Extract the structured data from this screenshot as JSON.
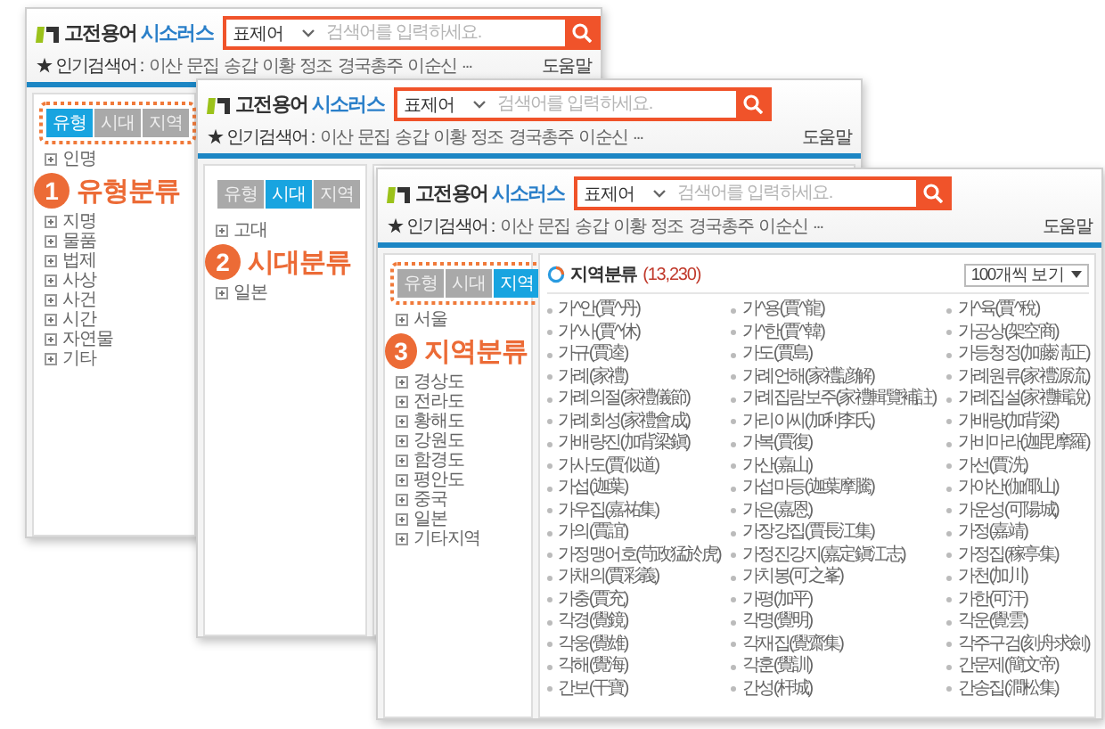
{
  "windows": [
    {
      "logo": {
        "name": "고전용어",
        "suffix": "시소러스"
      },
      "search": {
        "scope": "표제어",
        "placeholder": "검색어를 입력하세요."
      },
      "popular_searches": {
        "label": "★ 인기검색어 :",
        "terms": [
          "이산",
          "문집",
          "송갑",
          "이황",
          "정조",
          "경국총주",
          "이순신"
        ],
        "more": "..."
      },
      "help": "도움말",
      "tabs_highlighted": true,
      "tabs": [
        {
          "label": "유형",
          "selected": true
        },
        {
          "label": "시대",
          "selected": false
        },
        {
          "label": "지역",
          "selected": false
        }
      ],
      "categories": [
        "인명",
        "지명",
        "물품",
        "법제",
        "사상",
        "사건",
        "시간",
        "자연물",
        "기타"
      ],
      "callout": {
        "number": "1",
        "label": "유형분류"
      }
    },
    {
      "logo": {
        "name": "고전용어",
        "suffix": "시소러스"
      },
      "search": {
        "scope": "표제어",
        "placeholder": "검색어를 입력하세요."
      },
      "popular_searches": {
        "label": "★ 인기검색어 :",
        "terms": [
          "이산",
          "문집",
          "송갑",
          "이황",
          "정조",
          "경국총주",
          "이순신"
        ],
        "more": "..."
      },
      "help": "도움말",
      "tabs_highlighted": false,
      "tabs": [
        {
          "label": "유형",
          "selected": false
        },
        {
          "label": "시대",
          "selected": true
        },
        {
          "label": "지역",
          "selected": false
        }
      ],
      "categories": [
        "고대",
        "일본"
      ],
      "callout": {
        "number": "2",
        "label": "시대분류"
      }
    },
    {
      "logo": {
        "name": "고전용어",
        "suffix": "시소러스"
      },
      "search": {
        "scope": "표제어",
        "placeholder": "검색어를 입력하세요."
      },
      "popular_searches": {
        "label": "★ 인기검색어 :",
        "terms": [
          "이산",
          "문집",
          "송갑",
          "이황",
          "정조",
          "경국총주",
          "이순신"
        ],
        "more": "..."
      },
      "help": "도움말",
      "tabs_highlighted": true,
      "tabs": [
        {
          "label": "유형",
          "selected": false
        },
        {
          "label": "시대",
          "selected": false
        },
        {
          "label": "지역",
          "selected": true
        }
      ],
      "categories": [
        "서울",
        "경상도",
        "전라도",
        "황해도",
        "강원도",
        "함경도",
        "평안도",
        "중국",
        "일본",
        "기타지역"
      ],
      "callout": {
        "number": "3",
        "label": "지역분류"
      },
      "results": {
        "title": "지역분류",
        "count": "(13,230)",
        "page_size": "100개씩 보기",
        "terms": [
          "가^안(賈^丹)",
          "가^용(賈^龍)",
          "가^육(賈^稅)",
          "가^사(賈^休)",
          "가^한(賈^韓)",
          "가공상(架空商)",
          "가규(賈逵)",
          "가도(賈島)",
          "가등청정(加藤淸正)",
          "가례(家禮)",
          "가례언해(家禮諺解)",
          "가례원류(家禮源流)",
          "가례의절(家禮儀節)",
          "가례집람보주(家禮輯覽補註)",
          "가례집설(家禮輯說)",
          "가례회성(家禮會成)",
          "가리이씨(加利李氏)",
          "가배량(加背梁)",
          "가배량진(加背梁鎭)",
          "가복(賈復)",
          "가비마라(迦毘摩羅)",
          "가사도(賈似道)",
          "가산(嘉山)",
          "가선(賈洗)",
          "가섭(迦葉)",
          "가섭마등(迦葉摩騰)",
          "가야산(伽倻山)",
          "가우집(嘉祐集)",
          "가은(嘉恩)",
          "가운성(可陽城)",
          "가의(賈誼)",
          "가장강집(賈長江集)",
          "가정(嘉靖)",
          "가정맹어호(苛政猛於虎)",
          "가정진강지(嘉定鎭江志)",
          "가정집(稼亭集)",
          "가채의(賈彩義)",
          "가치봉(可之峯)",
          "가천(加川)",
          "가충(賈充)",
          "가평(加平)",
          "가한(可汗)",
          "각경(覺鏡)",
          "각명(覺明)",
          "각운(覺雲)",
          "각웅(覺雄)",
          "각재집(覺齋集)",
          "각주구검(刻舟求劍)",
          "각해(覺海)",
          "각훈(覺訓)",
          "간문제(簡文帝)",
          "간보(干寶)",
          "간성(杆城)",
          "간송집(澗松集)"
        ]
      }
    }
  ]
}
